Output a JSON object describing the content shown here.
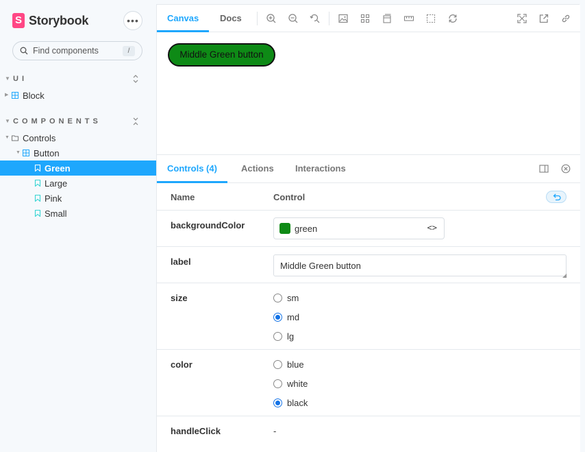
{
  "sidebar": {
    "brand": "Storybook",
    "logo_letter": "S",
    "menu": "•••",
    "search_placeholder": "Find components",
    "search_shortcut": "/",
    "sections": [
      {
        "title": "UI"
      },
      {
        "title": "COMPONENTS"
      }
    ],
    "ui_items": [
      {
        "label": "Block",
        "icon": "component-icon"
      }
    ],
    "tree": {
      "folder": "Controls",
      "component": "Button",
      "stories": [
        "Green",
        "Large",
        "Pink",
        "Small"
      ],
      "selected": "Green"
    }
  },
  "toolbar": {
    "tabs": [
      "Canvas",
      "Docs"
    ],
    "active_tab": "Canvas",
    "tools": [
      "zoom-in-icon",
      "zoom-out-icon",
      "zoom-reset-icon",
      "background-icon",
      "grid-icon",
      "viewport-icon",
      "measure-icon",
      "outline-icon",
      "refresh-icon",
      "fullscreen-icon",
      "open-new-tab-icon",
      "copy-link-icon"
    ]
  },
  "canvas": {
    "button_label": "Middle Green button",
    "button_color": "#0e8a16"
  },
  "panel": {
    "tabs": [
      "Controls (4)",
      "Actions",
      "Interactions"
    ],
    "active_tab": "Controls (4)",
    "headers": {
      "name": "Name",
      "control": "Control"
    },
    "controls": {
      "backgroundColor": {
        "name": "backgroundColor",
        "value": "green",
        "code_icon": "<>"
      },
      "label": {
        "name": "label",
        "value": "Middle Green button"
      },
      "size": {
        "name": "size",
        "options": [
          "sm",
          "md",
          "lg"
        ],
        "selected": "md"
      },
      "color": {
        "name": "color",
        "options": [
          "blue",
          "white",
          "black"
        ],
        "selected": "black"
      },
      "handleClick": {
        "name": "handleClick",
        "value": "-"
      }
    }
  },
  "colors": {
    "accent": "#1ea7fd",
    "brand": "#ff4785",
    "radio": "#1473e6"
  }
}
